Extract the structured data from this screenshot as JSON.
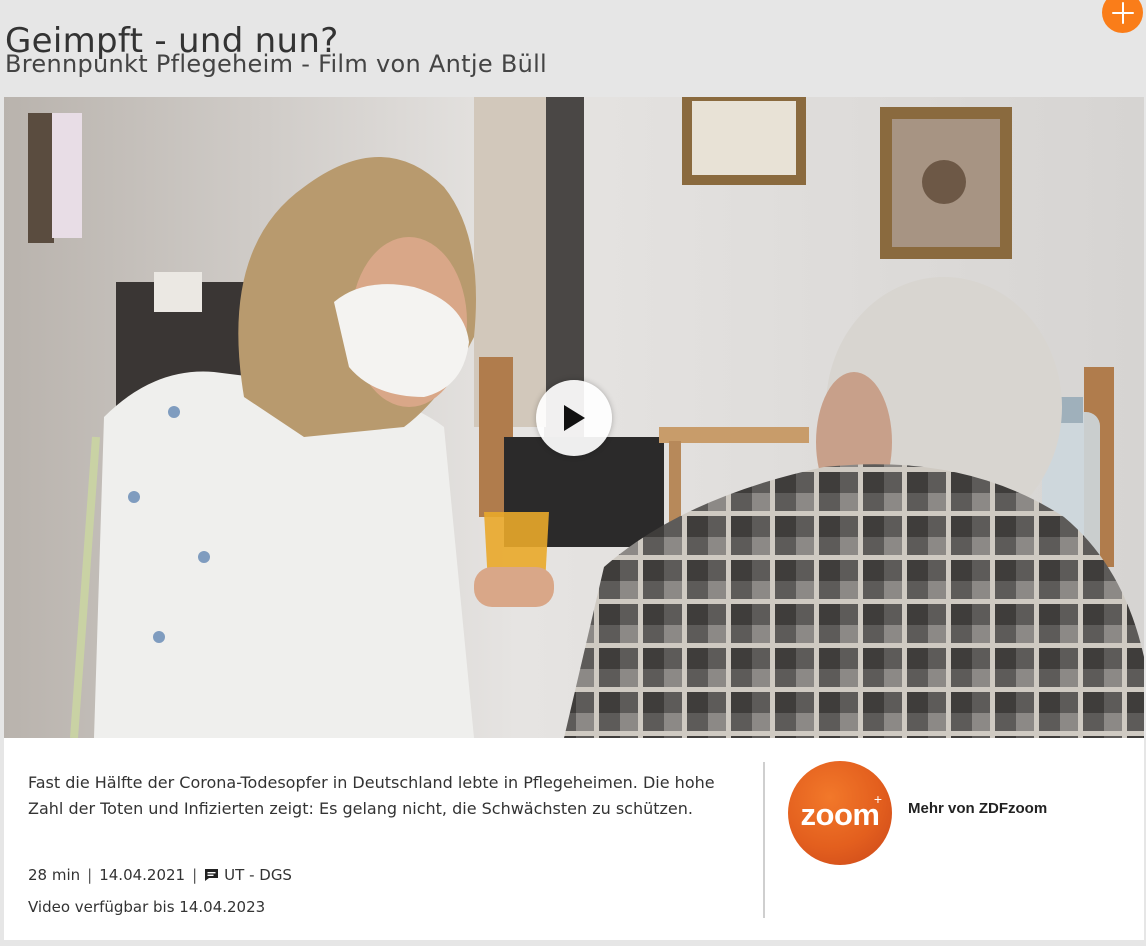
{
  "header": {
    "title": "Geimpft - und nun?",
    "subtitle": "Brennpunkt Pflegeheim - Film von Antje Büll",
    "add_icon": "plus-icon",
    "accent_color": "#fa7d19"
  },
  "player": {
    "play_icon": "play-icon"
  },
  "info": {
    "description": "Fast die Hälfte der Corona-Todesopfer in Deutschland lebte in Pflegeheimen. Die hohe Zahl der Toten und Infizierten zeigt: Es gelang nicht, die Schwächsten zu schützen.",
    "duration": "28 min",
    "date": "14.04.2021",
    "subtitles_icon": "subtitles-icon",
    "subtitles": "UT - DGS",
    "availability": "Video verfügbar bis 14.04.2023"
  },
  "channel": {
    "logo_text": "zoom",
    "logo_plus": "+",
    "more_label": "Mehr von ZDFzoom",
    "logo_color": "#e35f1e"
  }
}
